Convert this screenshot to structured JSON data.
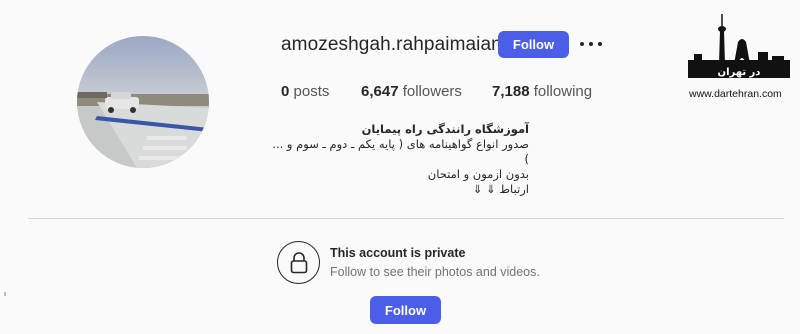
{
  "profile": {
    "username": "amozeshgah.rahpaimaian",
    "follow_label": "Follow"
  },
  "stats": {
    "posts_count": "0",
    "posts_label": "posts",
    "followers_count": "6,647",
    "followers_label": "followers",
    "following_count": "7,188",
    "following_label": "following"
  },
  "bio": {
    "name": "آموزشگاه رانندگی راه پیمایان",
    "line1": "صدور انواع گواهینامه های ( پایه یکم ـ دوم ـ سوم و ... )",
    "line2": "بدون ازمون و امتحان",
    "line3": "ارتباط ⇓ ⇓"
  },
  "private": {
    "title": "This account is private",
    "subtitle": "Follow to see their photos and videos.",
    "follow_label": "Follow"
  },
  "watermark": {
    "logo_text": "در تهران",
    "url": "www.dartehran.com"
  },
  "colors": {
    "accent": "#4c5de8",
    "background": "#fafafa",
    "text": "#262626",
    "muted": "#737373"
  },
  "icons": {
    "more": "more-options-icon",
    "lock": "lock-icon"
  }
}
